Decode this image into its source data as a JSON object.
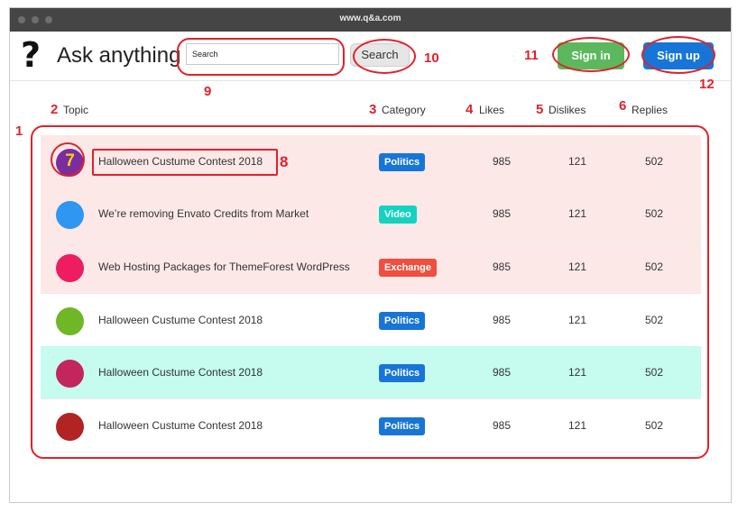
{
  "browser": {
    "url": "www.q&a.com"
  },
  "header": {
    "logo_glyph": "?",
    "site_title": "Ask anything",
    "search_placeholder": "Search",
    "search_button": "Search",
    "sign_in": "Sign in",
    "sign_up": "Sign up"
  },
  "columns": {
    "topic": "Topic",
    "category": "Category",
    "likes": "Likes",
    "dislikes": "Dislikes",
    "replies": "Replies"
  },
  "rows": [
    {
      "avatar_color": "#7b2d9e",
      "avatar_label": "7",
      "topic": "Halloween Custume Contest 2018",
      "category": "Politics",
      "category_color": "#1775d8",
      "likes": "985",
      "dislikes": "121",
      "replies": "502",
      "bg": "#fde8e8"
    },
    {
      "avatar_color": "#2f96f1",
      "avatar_label": "",
      "topic": "We’re removing Envato Credits from Market",
      "category": "Video",
      "category_color": "#14d2bf",
      "likes": "985",
      "dislikes": "121",
      "replies": "502",
      "bg": "#fde8e8"
    },
    {
      "avatar_color": "#ee1c61",
      "avatar_label": "",
      "topic": "Web Hosting Packages for ThemeForest WordPress",
      "category": "Exchange",
      "category_color": "#f04e3f",
      "likes": "985",
      "dislikes": "121",
      "replies": "502",
      "bg": "#fde8e8"
    },
    {
      "avatar_color": "#6fb726",
      "avatar_label": "",
      "topic": "Halloween Custume Contest 2018",
      "category": "Politics",
      "category_color": "#1775d8",
      "likes": "985",
      "dislikes": "121",
      "replies": "502",
      "bg": "#ffffff"
    },
    {
      "avatar_color": "#c2265c",
      "avatar_label": "",
      "topic": "Halloween Custume Contest 2018",
      "category": "Politics",
      "category_color": "#1775d8",
      "likes": "985",
      "dislikes": "121",
      "replies": "502",
      "bg": "#c5fcef"
    },
    {
      "avatar_color": "#b22323",
      "avatar_label": "",
      "topic": "Halloween Custume Contest 2018",
      "category": "Politics",
      "category_color": "#1775d8",
      "likes": "985",
      "dislikes": "121",
      "replies": "502",
      "bg": "#ffffff"
    }
  ],
  "annotations": {
    "a1": "1",
    "a2": "2",
    "a3": "3",
    "a4": "4",
    "a5": "5",
    "a6": "6",
    "a8": "8",
    "a9": "9",
    "a10": "10",
    "a11": "11",
    "a12": "12"
  }
}
